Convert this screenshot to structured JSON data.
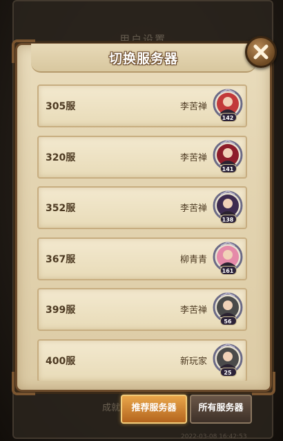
{
  "background": {
    "panel_title": "用户设置",
    "faded_label": "成就",
    "time_text": "2022-03-08 16:42:53"
  },
  "dialog": {
    "title": "切换服务器"
  },
  "servers": [
    {
      "name": "305服",
      "player": "李苦禅",
      "level": "142",
      "portrait": "red-haired-warrior",
      "color": "#c23a3a"
    },
    {
      "name": "320服",
      "player": "李苦禅",
      "level": "141",
      "portrait": "crimson-sorceress",
      "color": "#8d1d2a"
    },
    {
      "name": "352服",
      "player": "李苦禅",
      "level": "138",
      "portrait": "witch-with-hat",
      "color": "#3d2b4f"
    },
    {
      "name": "367服",
      "player": "柳青青",
      "level": "161",
      "portrait": "pink-haired-girl",
      "color": "#e58aa9"
    },
    {
      "name": "399服",
      "player": "李苦禅",
      "level": "56",
      "portrait": "bearded-warrior",
      "color": "#4a4a4a"
    },
    {
      "name": "400服",
      "player": "新玩家",
      "level": "25",
      "portrait": "bearded-warrior",
      "color": "#4a4a4a"
    }
  ],
  "tabs": {
    "recommended": "推荐服务器",
    "all": "所有服务器"
  },
  "colors": {
    "accent": "#e9a64a",
    "parchment": "#e9dcbc",
    "frame": "#6b4a2a"
  }
}
